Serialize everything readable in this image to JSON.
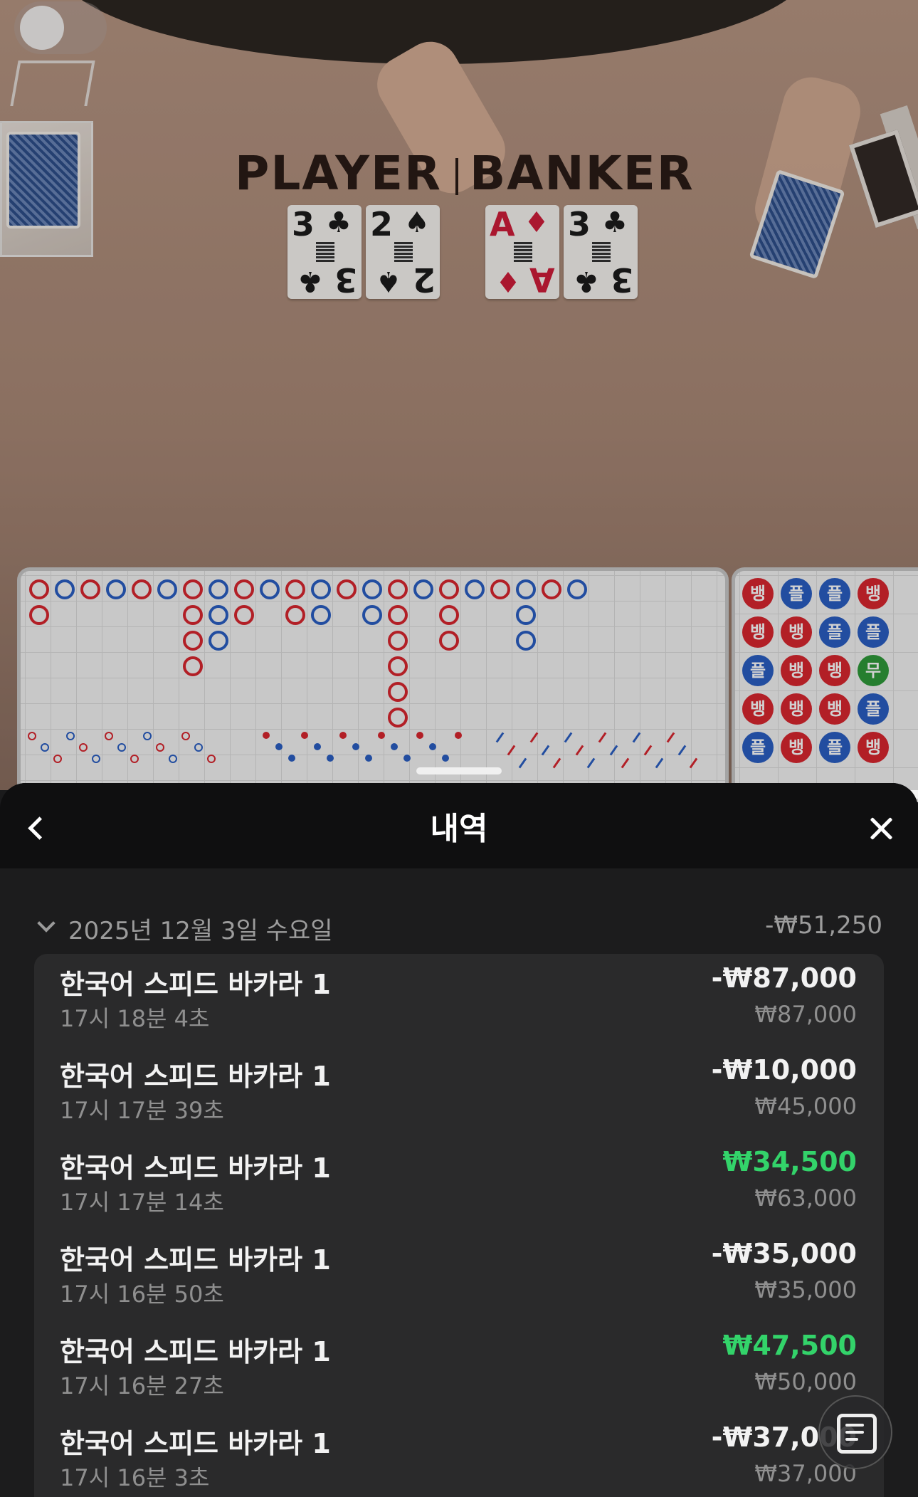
{
  "table": {
    "player_label": "PLAYER",
    "banker_label": "BANKER",
    "player_cards": [
      {
        "rank": "3",
        "suit": "♣",
        "color": "#1c1c1c"
      },
      {
        "rank": "2",
        "suit": "♠",
        "color": "#1c1c1c"
      }
    ],
    "banker_cards": [
      {
        "rank": "A",
        "suit": "♦",
        "color": "#d01d3a"
      },
      {
        "rank": "3",
        "suit": "♣",
        "color": "#1c1c1c"
      }
    ]
  },
  "bead_road": {
    "labels": {
      "banker": "뱅",
      "player": "플",
      "tie": "무"
    },
    "colors": {
      "banker": "#d9262f",
      "player": "#2a5fc4",
      "tie": "#2f9a3a"
    },
    "rows": [
      [
        "뱅",
        "플",
        "플",
        "뱅"
      ],
      [
        "뱅",
        "뱅",
        "플",
        "플"
      ],
      [
        "플",
        "뱅",
        "뱅",
        "무"
      ],
      [
        "뱅",
        "뱅",
        "뱅",
        "플"
      ],
      [
        "플",
        "뱅",
        "플",
        "뱅"
      ]
    ]
  },
  "sheet": {
    "title": "내역",
    "back_icon": "chevron-left-icon",
    "close_icon": "close-icon",
    "day": {
      "label": "2025년 12월 3일 수요일",
      "total": "-₩51,250"
    },
    "entries": [
      {
        "name": "한국어 스피드 바카라 1",
        "time": "17시 18분 4초",
        "amount": "-₩87,000",
        "bet": "₩87,000",
        "win": false
      },
      {
        "name": "한국어 스피드 바카라 1",
        "time": "17시 17분 39초",
        "amount": "-₩10,000",
        "bet": "₩45,000",
        "win": false
      },
      {
        "name": "한국어 스피드 바카라 1",
        "time": "17시 17분 14초",
        "amount": "₩34,500",
        "bet": "₩63,000",
        "win": true
      },
      {
        "name": "한국어 스피드 바카라 1",
        "time": "17시 16분 50초",
        "amount": "-₩35,000",
        "bet": "₩35,000",
        "win": false
      },
      {
        "name": "한국어 스피드 바카라 1",
        "time": "17시 16분 27초",
        "amount": "₩47,500",
        "bet": "₩50,000",
        "win": true
      },
      {
        "name": "한국어 스피드 바카라 1",
        "time": "17시 16분 3초",
        "amount": "-₩37,000",
        "bet": "₩37,000",
        "win": false
      }
    ],
    "colors": {
      "win": "#33d36a",
      "loss": "#f2f2f2"
    }
  }
}
